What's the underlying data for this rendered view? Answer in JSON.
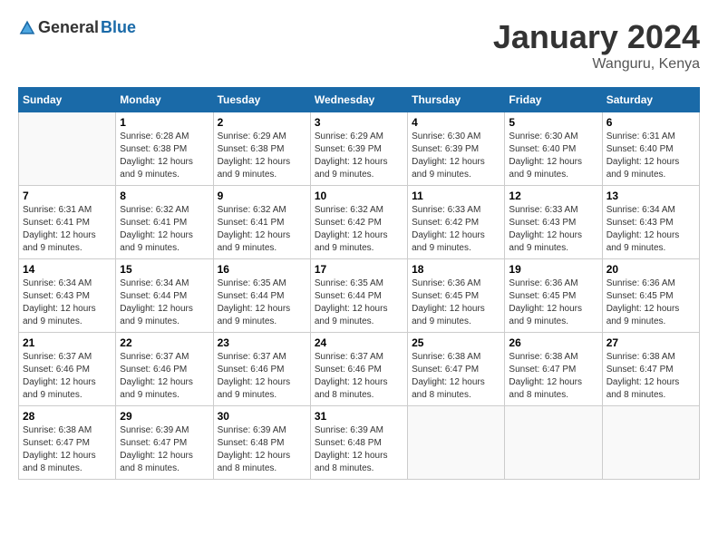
{
  "header": {
    "logo_general": "General",
    "logo_blue": "Blue",
    "month_title": "January 2024",
    "location": "Wanguru, Kenya"
  },
  "days_of_week": [
    "Sunday",
    "Monday",
    "Tuesday",
    "Wednesday",
    "Thursday",
    "Friday",
    "Saturday"
  ],
  "weeks": [
    [
      {
        "day": "",
        "sunrise": "",
        "sunset": "",
        "daylight": ""
      },
      {
        "day": "1",
        "sunrise": "Sunrise: 6:28 AM",
        "sunset": "Sunset: 6:38 PM",
        "daylight": "Daylight: 12 hours and 9 minutes."
      },
      {
        "day": "2",
        "sunrise": "Sunrise: 6:29 AM",
        "sunset": "Sunset: 6:38 PM",
        "daylight": "Daylight: 12 hours and 9 minutes."
      },
      {
        "day": "3",
        "sunrise": "Sunrise: 6:29 AM",
        "sunset": "Sunset: 6:39 PM",
        "daylight": "Daylight: 12 hours and 9 minutes."
      },
      {
        "day": "4",
        "sunrise": "Sunrise: 6:30 AM",
        "sunset": "Sunset: 6:39 PM",
        "daylight": "Daylight: 12 hours and 9 minutes."
      },
      {
        "day": "5",
        "sunrise": "Sunrise: 6:30 AM",
        "sunset": "Sunset: 6:40 PM",
        "daylight": "Daylight: 12 hours and 9 minutes."
      },
      {
        "day": "6",
        "sunrise": "Sunrise: 6:31 AM",
        "sunset": "Sunset: 6:40 PM",
        "daylight": "Daylight: 12 hours and 9 minutes."
      }
    ],
    [
      {
        "day": "7",
        "sunrise": "Sunrise: 6:31 AM",
        "sunset": "Sunset: 6:41 PM",
        "daylight": "Daylight: 12 hours and 9 minutes."
      },
      {
        "day": "8",
        "sunrise": "Sunrise: 6:32 AM",
        "sunset": "Sunset: 6:41 PM",
        "daylight": "Daylight: 12 hours and 9 minutes."
      },
      {
        "day": "9",
        "sunrise": "Sunrise: 6:32 AM",
        "sunset": "Sunset: 6:41 PM",
        "daylight": "Daylight: 12 hours and 9 minutes."
      },
      {
        "day": "10",
        "sunrise": "Sunrise: 6:32 AM",
        "sunset": "Sunset: 6:42 PM",
        "daylight": "Daylight: 12 hours and 9 minutes."
      },
      {
        "day": "11",
        "sunrise": "Sunrise: 6:33 AM",
        "sunset": "Sunset: 6:42 PM",
        "daylight": "Daylight: 12 hours and 9 minutes."
      },
      {
        "day": "12",
        "sunrise": "Sunrise: 6:33 AM",
        "sunset": "Sunset: 6:43 PM",
        "daylight": "Daylight: 12 hours and 9 minutes."
      },
      {
        "day": "13",
        "sunrise": "Sunrise: 6:34 AM",
        "sunset": "Sunset: 6:43 PM",
        "daylight": "Daylight: 12 hours and 9 minutes."
      }
    ],
    [
      {
        "day": "14",
        "sunrise": "Sunrise: 6:34 AM",
        "sunset": "Sunset: 6:43 PM",
        "daylight": "Daylight: 12 hours and 9 minutes."
      },
      {
        "day": "15",
        "sunrise": "Sunrise: 6:34 AM",
        "sunset": "Sunset: 6:44 PM",
        "daylight": "Daylight: 12 hours and 9 minutes."
      },
      {
        "day": "16",
        "sunrise": "Sunrise: 6:35 AM",
        "sunset": "Sunset: 6:44 PM",
        "daylight": "Daylight: 12 hours and 9 minutes."
      },
      {
        "day": "17",
        "sunrise": "Sunrise: 6:35 AM",
        "sunset": "Sunset: 6:44 PM",
        "daylight": "Daylight: 12 hours and 9 minutes."
      },
      {
        "day": "18",
        "sunrise": "Sunrise: 6:36 AM",
        "sunset": "Sunset: 6:45 PM",
        "daylight": "Daylight: 12 hours and 9 minutes."
      },
      {
        "day": "19",
        "sunrise": "Sunrise: 6:36 AM",
        "sunset": "Sunset: 6:45 PM",
        "daylight": "Daylight: 12 hours and 9 minutes."
      },
      {
        "day": "20",
        "sunrise": "Sunrise: 6:36 AM",
        "sunset": "Sunset: 6:45 PM",
        "daylight": "Daylight: 12 hours and 9 minutes."
      }
    ],
    [
      {
        "day": "21",
        "sunrise": "Sunrise: 6:37 AM",
        "sunset": "Sunset: 6:46 PM",
        "daylight": "Daylight: 12 hours and 9 minutes."
      },
      {
        "day": "22",
        "sunrise": "Sunrise: 6:37 AM",
        "sunset": "Sunset: 6:46 PM",
        "daylight": "Daylight: 12 hours and 9 minutes."
      },
      {
        "day": "23",
        "sunrise": "Sunrise: 6:37 AM",
        "sunset": "Sunset: 6:46 PM",
        "daylight": "Daylight: 12 hours and 9 minutes."
      },
      {
        "day": "24",
        "sunrise": "Sunrise: 6:37 AM",
        "sunset": "Sunset: 6:46 PM",
        "daylight": "Daylight: 12 hours and 8 minutes."
      },
      {
        "day": "25",
        "sunrise": "Sunrise: 6:38 AM",
        "sunset": "Sunset: 6:47 PM",
        "daylight": "Daylight: 12 hours and 8 minutes."
      },
      {
        "day": "26",
        "sunrise": "Sunrise: 6:38 AM",
        "sunset": "Sunset: 6:47 PM",
        "daylight": "Daylight: 12 hours and 8 minutes."
      },
      {
        "day": "27",
        "sunrise": "Sunrise: 6:38 AM",
        "sunset": "Sunset: 6:47 PM",
        "daylight": "Daylight: 12 hours and 8 minutes."
      }
    ],
    [
      {
        "day": "28",
        "sunrise": "Sunrise: 6:38 AM",
        "sunset": "Sunset: 6:47 PM",
        "daylight": "Daylight: 12 hours and 8 minutes."
      },
      {
        "day": "29",
        "sunrise": "Sunrise: 6:39 AM",
        "sunset": "Sunset: 6:47 PM",
        "daylight": "Daylight: 12 hours and 8 minutes."
      },
      {
        "day": "30",
        "sunrise": "Sunrise: 6:39 AM",
        "sunset": "Sunset: 6:48 PM",
        "daylight": "Daylight: 12 hours and 8 minutes."
      },
      {
        "day": "31",
        "sunrise": "Sunrise: 6:39 AM",
        "sunset": "Sunset: 6:48 PM",
        "daylight": "Daylight: 12 hours and 8 minutes."
      },
      {
        "day": "",
        "sunrise": "",
        "sunset": "",
        "daylight": ""
      },
      {
        "day": "",
        "sunrise": "",
        "sunset": "",
        "daylight": ""
      },
      {
        "day": "",
        "sunrise": "",
        "sunset": "",
        "daylight": ""
      }
    ]
  ]
}
